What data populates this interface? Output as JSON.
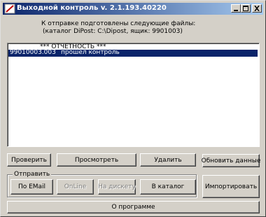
{
  "window": {
    "title": "Выходной контроль v. 2.1.193.40220",
    "icon": "red-slash-app-icon",
    "controls": [
      "minimize-icon",
      "maximize-icon",
      "close-icon"
    ]
  },
  "info": {
    "line1": "К отправке подготовлены следующие файлы:",
    "line2": "(каталог DiPost: C:\\Dipost, ящик: 9901003)"
  },
  "list": {
    "header": "*** ОТЧЕТНОСТЬ ***",
    "rows": [
      {
        "file": "99010003.003",
        "status": "прошел контроль",
        "selected": true
      }
    ]
  },
  "buttons": {
    "check": "Проверить",
    "view": "Просмотреть",
    "delete": "Удалить",
    "refresh": "Обновить данные",
    "email": "По EMail",
    "online": "OnLine",
    "disk": "На дискету",
    "catalog": "В каталог",
    "import": "Импортировать",
    "about": "О программе"
  },
  "send_group": {
    "label": "Отправить"
  },
  "colors": {
    "face": "#d4d0c8",
    "title_start": "#0a246a",
    "title_end": "#a6caf0",
    "selection": "#0a246a"
  }
}
